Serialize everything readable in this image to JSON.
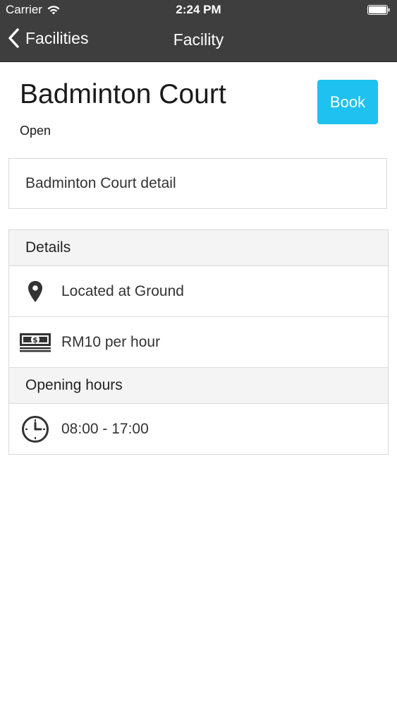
{
  "status_bar": {
    "carrier": "Carrier",
    "time": "2:24 PM"
  },
  "nav": {
    "back_label": "Facilities",
    "title": "Facility"
  },
  "facility": {
    "name": "Badminton Court",
    "status": "Open",
    "book_label": "Book",
    "description": "Badminton Court detail"
  },
  "details": {
    "header": "Details",
    "location": "Located at Ground",
    "price": "RM10 per hour"
  },
  "opening_hours": {
    "header": "Opening hours",
    "hours": "08:00 - 17:00"
  },
  "colors": {
    "nav_bg": "#3e3e3e",
    "accent": "#1ec1ef"
  }
}
